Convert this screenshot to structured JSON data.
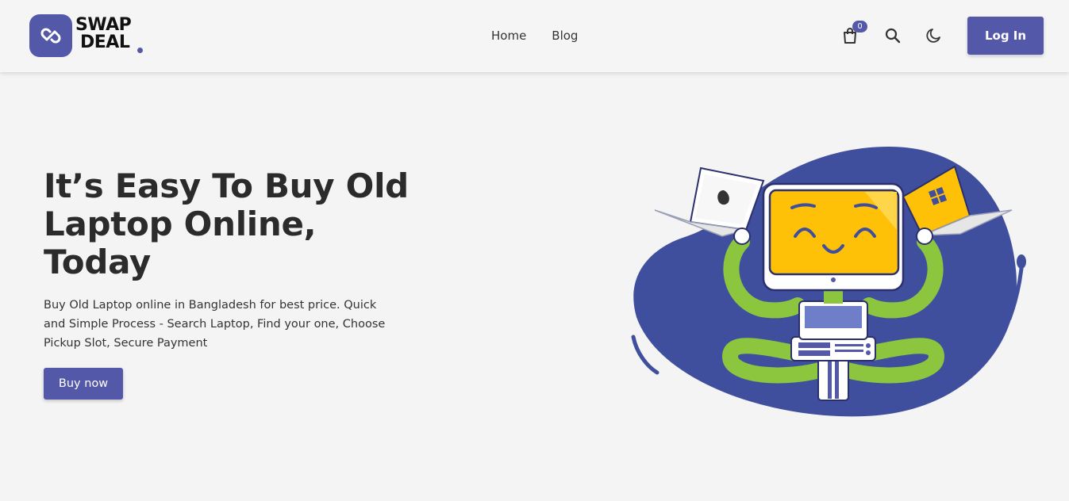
{
  "brand": {
    "line1": "SWAP",
    "line2": "DEAL",
    "color": "#5458a8"
  },
  "nav": {
    "home": "Home",
    "blog": "Blog"
  },
  "cart": {
    "count": "0"
  },
  "icons": [
    "cart-icon",
    "search-icon",
    "moon-icon",
    "apple-logo-icon",
    "windows-logo-icon"
  ],
  "login_label": "Log In",
  "hero": {
    "title": "It’s Easy To Buy Old Laptop Online, Today",
    "text": "Buy Old Laptop online in Bangladesh for best price. Quick and Simple Process - Search Laptop, Find your one, Choose Pickup Slot, Secure Payment",
    "cta": "Buy now"
  },
  "colors": {
    "accent": "#5458a8",
    "blob": "#3f4f9e",
    "screen": "#ffc107",
    "arm": "#8cc63f",
    "background": "#f4f4f4"
  }
}
